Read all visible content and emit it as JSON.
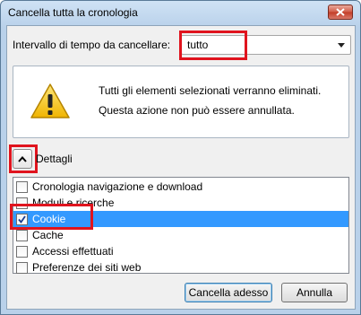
{
  "window": {
    "title": "Cancella tutta la cronologia"
  },
  "range": {
    "label": "Intervallo di tempo da cancellare:",
    "selected": "tutto"
  },
  "warning": {
    "line1": "Tutti gli elementi selezionati verranno eliminati.",
    "line2": "Questa azione non può essere annullata."
  },
  "details": {
    "label": "Dettagli"
  },
  "items": [
    {
      "label": "Cronologia navigazione e download",
      "checked": false,
      "selected": false
    },
    {
      "label": "Moduli e ricerche",
      "checked": false,
      "selected": false
    },
    {
      "label": "Cookie",
      "checked": true,
      "selected": true
    },
    {
      "label": "Cache",
      "checked": false,
      "selected": false
    },
    {
      "label": "Accessi effettuati",
      "checked": false,
      "selected": false
    },
    {
      "label": "Preferenze dei siti web",
      "checked": false,
      "selected": false
    }
  ],
  "buttons": {
    "confirm": "Cancella adesso",
    "cancel": "Annulla"
  },
  "icons": {
    "close": "close-icon",
    "warning": "warning-icon",
    "collapse": "chevron-up-icon",
    "check": "checkmark-icon"
  },
  "colors": {
    "selection": "#3399ff",
    "highlight": "#e0141e",
    "warning_fill": "#f5c211"
  }
}
